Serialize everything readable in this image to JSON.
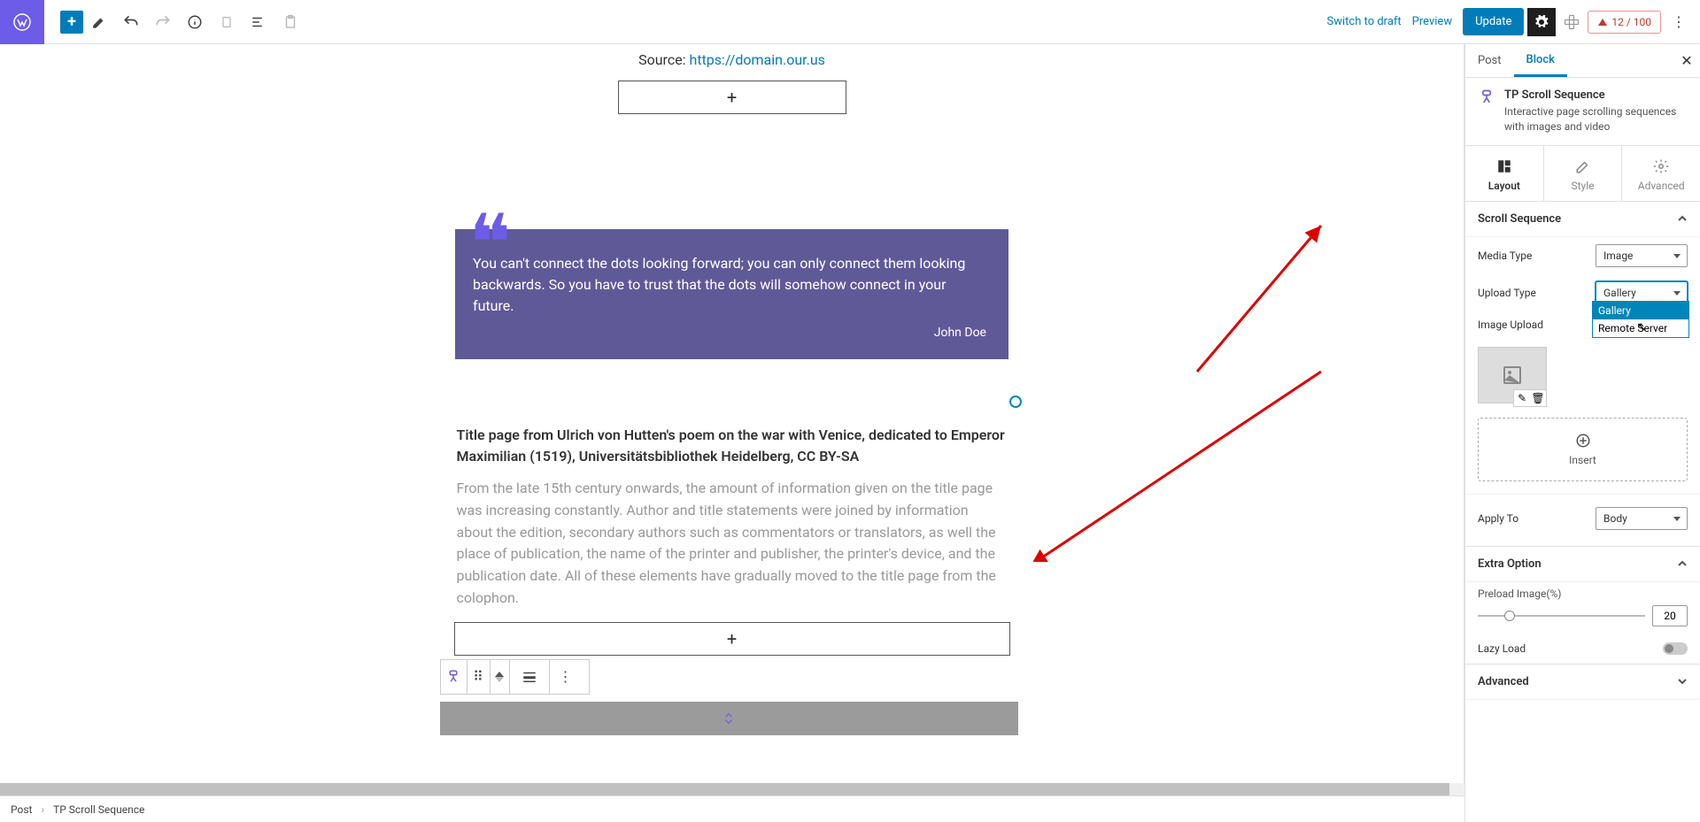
{
  "topbar": {
    "switch_draft": "Switch to draft",
    "preview": "Preview",
    "update": "Update",
    "credits": "12 / 100"
  },
  "sidebar": {
    "tabs": {
      "post": "Post",
      "block": "Block"
    },
    "block": {
      "name": "TP Scroll Sequence",
      "desc": "Interactive page scrolling sequences with images and video"
    },
    "subtabs": {
      "layout": "Layout",
      "style": "Style",
      "advanced": "Advanced"
    },
    "panel_scroll": "Scroll Sequence",
    "media_type_label": "Media Type",
    "media_type_value": "Image",
    "upload_type_label": "Upload Type",
    "upload_type_value": "Gallery",
    "upload_options": [
      "Gallery",
      "Remote Server"
    ],
    "image_upload_label": "Image Upload",
    "insert_label": "Insert",
    "apply_to_label": "Apply To",
    "apply_to_value": "Body",
    "panel_extra": "Extra Option",
    "preload_label": "Preload Image(%)",
    "preload_value": "20",
    "lazy_label": "Lazy Load",
    "panel_advanced": "Advanced"
  },
  "editor": {
    "source_prefix": "Source: ",
    "source_link": "https://domain.our.us",
    "quote_text": "You can't connect the dots looking forward; you can only connect them looking backwards. So you have to trust that the dots will somehow connect in your future.",
    "quote_author": "John Doe",
    "title_heading": "Title page from Ulrich von Hutten's poem on the war with Venice, dedicated to Emperor Maximilian (1519), Universitätsbibliothek Heidelberg, CC BY-SA",
    "title_para": "From the late 15th century onwards, the amount of information given on the title page was increasing constantly. Author and title statements were joined by information about the edition, secondary authors such as commentators or translators, as well the place of publication, the name of the printer and publisher, the printer's device, and the publication date. All of these elements have gradually moved to the title page from the colophon."
  },
  "breadcrumb": {
    "post": "Post",
    "block": "TP Scroll Sequence"
  }
}
